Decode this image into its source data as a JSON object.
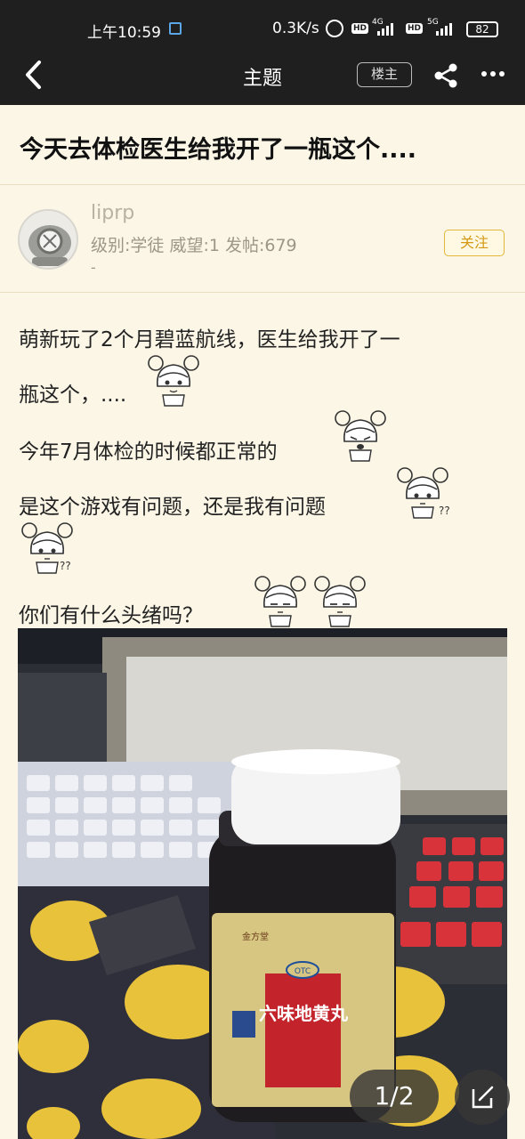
{
  "status_bar": {
    "time": "上午10:59",
    "net_speed": "0.3K/s",
    "hd1": "HD",
    "net1": "4G",
    "hd2": "HD",
    "net2": "5G",
    "battery": "82"
  },
  "nav": {
    "back_icon": "chevron-left-icon",
    "title": "主题",
    "owner_label": "楼主",
    "share_icon": "share-icon",
    "more_icon": "more-icon"
  },
  "post": {
    "title": "今天去体检医生给我开了一瓶这个...."
  },
  "author": {
    "name": "liprp",
    "meta": "级别:学徒 威望:1 发帖:679",
    "dash": "-",
    "follow_label": "关注"
  },
  "content": {
    "lines": [
      "萌新玩了2个月碧蓝航线，医生给我开了一",
      "瓶这个，....",
      "今年7月体检的时候都正常的",
      "是这个游戏有问题，还是我有问题",
      "你们有什么头绪吗？"
    ]
  },
  "photo": {
    "otc": "OTC",
    "medicine_name": "六味地黄丸",
    "brand": "金方堂"
  },
  "pager": {
    "indicator": "1/2",
    "edit_icon": "edit-icon"
  },
  "colors": {
    "background": "#fbf6e6",
    "bar": "#1f1f1f",
    "accent": "#d49a14"
  }
}
